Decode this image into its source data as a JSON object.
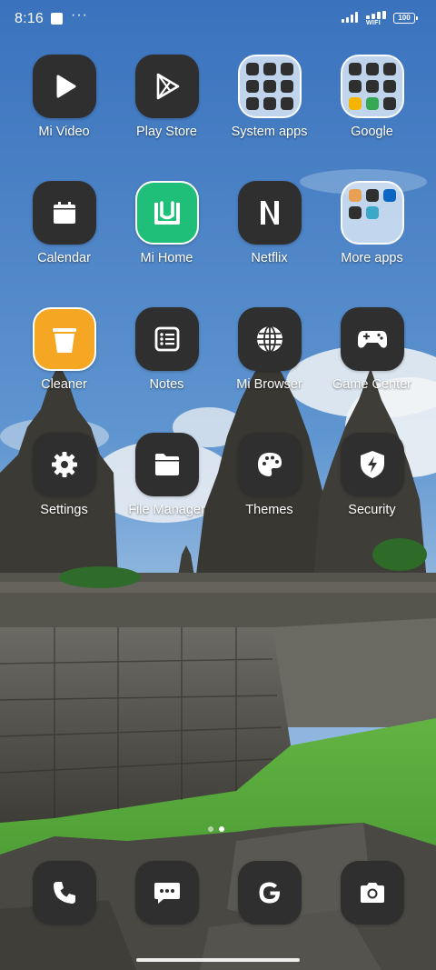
{
  "status_bar": {
    "time": "8:16",
    "more": "···",
    "wifi_label": "WIFI",
    "battery": "100"
  },
  "apps": [
    {
      "label": "Mi Video",
      "icon": "play-icon"
    },
    {
      "label": "Play Store",
      "icon": "play-store-icon"
    },
    {
      "label": "System apps",
      "icon": "folder-icon"
    },
    {
      "label": "Google",
      "icon": "folder-icon"
    },
    {
      "label": "Calendar",
      "icon": "calendar-icon"
    },
    {
      "label": "Mi Home",
      "icon": "mi-home-icon"
    },
    {
      "label": "Netflix",
      "icon": "netflix-icon"
    },
    {
      "label": "More apps",
      "icon": "folder-icon"
    },
    {
      "label": "Cleaner",
      "icon": "trash-icon"
    },
    {
      "label": "Notes",
      "icon": "notes-icon"
    },
    {
      "label": "Mi Browser",
      "icon": "globe-icon"
    },
    {
      "label": "Game Center",
      "icon": "gamepad-icon"
    },
    {
      "label": "Settings",
      "icon": "gear-icon"
    },
    {
      "label": "File Manager",
      "icon": "folder-file-icon"
    },
    {
      "label": "Themes",
      "icon": "palette-icon"
    },
    {
      "label": "Security",
      "icon": "shield-icon"
    }
  ],
  "dock": [
    {
      "name": "phone",
      "icon": "phone-icon"
    },
    {
      "name": "messages",
      "icon": "message-icon"
    },
    {
      "name": "google",
      "icon": "google-icon"
    },
    {
      "name": "camera",
      "icon": "camera-icon"
    }
  ],
  "colors": {
    "icon_bg": "#2f2f2f",
    "mi_home_green": "#1fbf7a",
    "cleaner_orange": "#f5a623",
    "sky": "#3f79c4",
    "grass": "#4fa83a"
  },
  "page_indicator": {
    "pages": 2,
    "current": 2
  }
}
